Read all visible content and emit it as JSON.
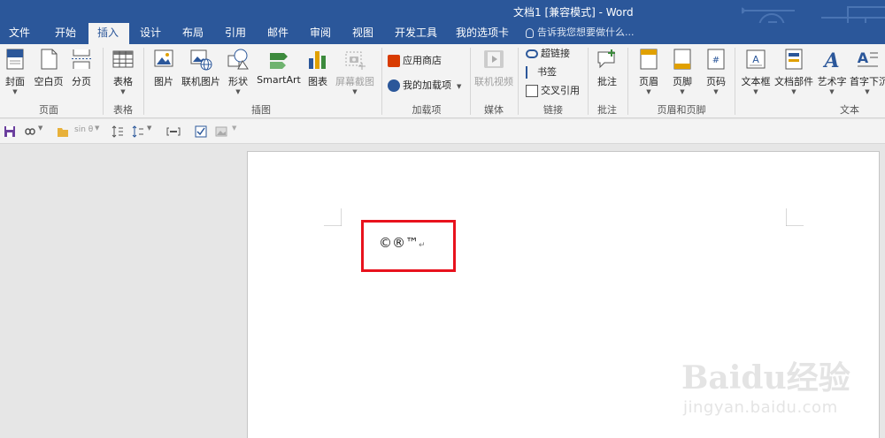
{
  "window": {
    "title": "文档1 [兼容模式] - Word"
  },
  "tabs": [
    "文件",
    "开始",
    "插入",
    "设计",
    "布局",
    "引用",
    "邮件",
    "审阅",
    "视图",
    "开发工具",
    "我的选项卡"
  ],
  "active_tab": "插入",
  "tell_me": "告诉我您想要做什么...",
  "ribbon": {
    "pages": {
      "cover": "封面",
      "blank": "空白页",
      "break": "分页",
      "group": "页面"
    },
    "tables": {
      "table": "表格",
      "group": "表格"
    },
    "illustrations": {
      "picture": "图片",
      "online_picture": "联机图片",
      "shapes": "形状",
      "smartart": "SmartArt",
      "chart": "图表",
      "screenshot": "屏幕截图",
      "group": "插图"
    },
    "addins": {
      "store": "应用商店",
      "my_addins": "我的加载项",
      "group": "加载项"
    },
    "media": {
      "online_video": "联机视频",
      "group": "媒体"
    },
    "links": {
      "hyperlink": "超链接",
      "bookmark": "书签",
      "cross_ref": "交叉引用",
      "group": "链接"
    },
    "comments": {
      "comment": "批注",
      "group": "批注"
    },
    "header_footer": {
      "header": "页眉",
      "footer": "页脚",
      "page_number": "页码",
      "group": "页眉和页脚"
    },
    "text": {
      "textbox": "文本框",
      "quick_parts": "文档部件",
      "wordart": "艺术字",
      "dropcap": "首字下沉",
      "group": "文本"
    }
  },
  "qat": {
    "equation_label": "sin θ"
  },
  "document": {
    "content": "©®™",
    "paragraph_mark": "↵"
  },
  "watermark": {
    "brand": "Baidu经验",
    "site": "jingyan.baidu.com"
  },
  "colors": {
    "accent": "#2b579a",
    "highlight": "#e8121d"
  }
}
